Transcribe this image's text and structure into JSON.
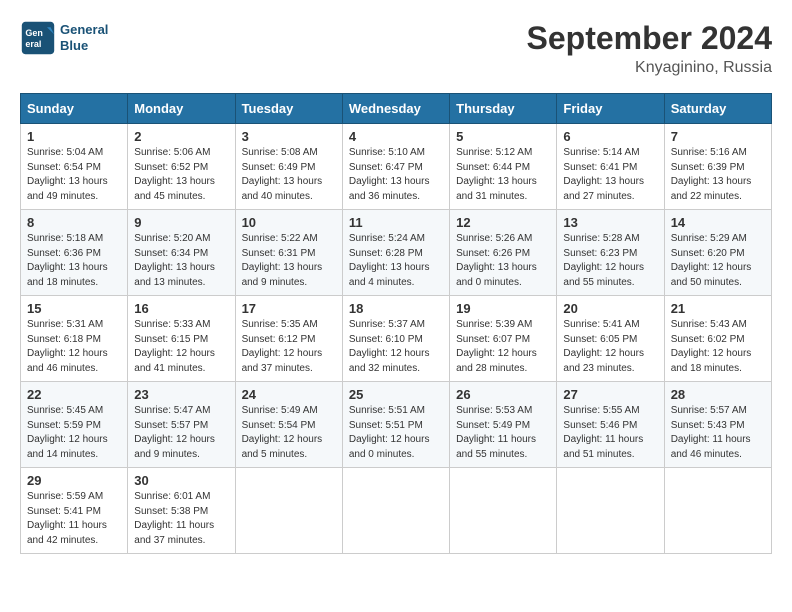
{
  "header": {
    "logo_line1": "General",
    "logo_line2": "Blue",
    "month": "September 2024",
    "location": "Knyaginino, Russia"
  },
  "weekdays": [
    "Sunday",
    "Monday",
    "Tuesday",
    "Wednesday",
    "Thursday",
    "Friday",
    "Saturday"
  ],
  "weeks": [
    [
      {
        "day": "1",
        "lines": [
          "Sunrise: 5:04 AM",
          "Sunset: 6:54 PM",
          "Daylight: 13 hours",
          "and 49 minutes."
        ]
      },
      {
        "day": "2",
        "lines": [
          "Sunrise: 5:06 AM",
          "Sunset: 6:52 PM",
          "Daylight: 13 hours",
          "and 45 minutes."
        ]
      },
      {
        "day": "3",
        "lines": [
          "Sunrise: 5:08 AM",
          "Sunset: 6:49 PM",
          "Daylight: 13 hours",
          "and 40 minutes."
        ]
      },
      {
        "day": "4",
        "lines": [
          "Sunrise: 5:10 AM",
          "Sunset: 6:47 PM",
          "Daylight: 13 hours",
          "and 36 minutes."
        ]
      },
      {
        "day": "5",
        "lines": [
          "Sunrise: 5:12 AM",
          "Sunset: 6:44 PM",
          "Daylight: 13 hours",
          "and 31 minutes."
        ]
      },
      {
        "day": "6",
        "lines": [
          "Sunrise: 5:14 AM",
          "Sunset: 6:41 PM",
          "Daylight: 13 hours",
          "and 27 minutes."
        ]
      },
      {
        "day": "7",
        "lines": [
          "Sunrise: 5:16 AM",
          "Sunset: 6:39 PM",
          "Daylight: 13 hours",
          "and 22 minutes."
        ]
      }
    ],
    [
      {
        "day": "8",
        "lines": [
          "Sunrise: 5:18 AM",
          "Sunset: 6:36 PM",
          "Daylight: 13 hours",
          "and 18 minutes."
        ]
      },
      {
        "day": "9",
        "lines": [
          "Sunrise: 5:20 AM",
          "Sunset: 6:34 PM",
          "Daylight: 13 hours",
          "and 13 minutes."
        ]
      },
      {
        "day": "10",
        "lines": [
          "Sunrise: 5:22 AM",
          "Sunset: 6:31 PM",
          "Daylight: 13 hours",
          "and 9 minutes."
        ]
      },
      {
        "day": "11",
        "lines": [
          "Sunrise: 5:24 AM",
          "Sunset: 6:28 PM",
          "Daylight: 13 hours",
          "and 4 minutes."
        ]
      },
      {
        "day": "12",
        "lines": [
          "Sunrise: 5:26 AM",
          "Sunset: 6:26 PM",
          "Daylight: 13 hours",
          "and 0 minutes."
        ]
      },
      {
        "day": "13",
        "lines": [
          "Sunrise: 5:28 AM",
          "Sunset: 6:23 PM",
          "Daylight: 12 hours",
          "and 55 minutes."
        ]
      },
      {
        "day": "14",
        "lines": [
          "Sunrise: 5:29 AM",
          "Sunset: 6:20 PM",
          "Daylight: 12 hours",
          "and 50 minutes."
        ]
      }
    ],
    [
      {
        "day": "15",
        "lines": [
          "Sunrise: 5:31 AM",
          "Sunset: 6:18 PM",
          "Daylight: 12 hours",
          "and 46 minutes."
        ]
      },
      {
        "day": "16",
        "lines": [
          "Sunrise: 5:33 AM",
          "Sunset: 6:15 PM",
          "Daylight: 12 hours",
          "and 41 minutes."
        ]
      },
      {
        "day": "17",
        "lines": [
          "Sunrise: 5:35 AM",
          "Sunset: 6:12 PM",
          "Daylight: 12 hours",
          "and 37 minutes."
        ]
      },
      {
        "day": "18",
        "lines": [
          "Sunrise: 5:37 AM",
          "Sunset: 6:10 PM",
          "Daylight: 12 hours",
          "and 32 minutes."
        ]
      },
      {
        "day": "19",
        "lines": [
          "Sunrise: 5:39 AM",
          "Sunset: 6:07 PM",
          "Daylight: 12 hours",
          "and 28 minutes."
        ]
      },
      {
        "day": "20",
        "lines": [
          "Sunrise: 5:41 AM",
          "Sunset: 6:05 PM",
          "Daylight: 12 hours",
          "and 23 minutes."
        ]
      },
      {
        "day": "21",
        "lines": [
          "Sunrise: 5:43 AM",
          "Sunset: 6:02 PM",
          "Daylight: 12 hours",
          "and 18 minutes."
        ]
      }
    ],
    [
      {
        "day": "22",
        "lines": [
          "Sunrise: 5:45 AM",
          "Sunset: 5:59 PM",
          "Daylight: 12 hours",
          "and 14 minutes."
        ]
      },
      {
        "day": "23",
        "lines": [
          "Sunrise: 5:47 AM",
          "Sunset: 5:57 PM",
          "Daylight: 12 hours",
          "and 9 minutes."
        ]
      },
      {
        "day": "24",
        "lines": [
          "Sunrise: 5:49 AM",
          "Sunset: 5:54 PM",
          "Daylight: 12 hours",
          "and 5 minutes."
        ]
      },
      {
        "day": "25",
        "lines": [
          "Sunrise: 5:51 AM",
          "Sunset: 5:51 PM",
          "Daylight: 12 hours",
          "and 0 minutes."
        ]
      },
      {
        "day": "26",
        "lines": [
          "Sunrise: 5:53 AM",
          "Sunset: 5:49 PM",
          "Daylight: 11 hours",
          "and 55 minutes."
        ]
      },
      {
        "day": "27",
        "lines": [
          "Sunrise: 5:55 AM",
          "Sunset: 5:46 PM",
          "Daylight: 11 hours",
          "and 51 minutes."
        ]
      },
      {
        "day": "28",
        "lines": [
          "Sunrise: 5:57 AM",
          "Sunset: 5:43 PM",
          "Daylight: 11 hours",
          "and 46 minutes."
        ]
      }
    ],
    [
      {
        "day": "29",
        "lines": [
          "Sunrise: 5:59 AM",
          "Sunset: 5:41 PM",
          "Daylight: 11 hours",
          "and 42 minutes."
        ]
      },
      {
        "day": "30",
        "lines": [
          "Sunrise: 6:01 AM",
          "Sunset: 5:38 PM",
          "Daylight: 11 hours",
          "and 37 minutes."
        ]
      },
      {
        "day": "",
        "lines": []
      },
      {
        "day": "",
        "lines": []
      },
      {
        "day": "",
        "lines": []
      },
      {
        "day": "",
        "lines": []
      },
      {
        "day": "",
        "lines": []
      }
    ]
  ]
}
